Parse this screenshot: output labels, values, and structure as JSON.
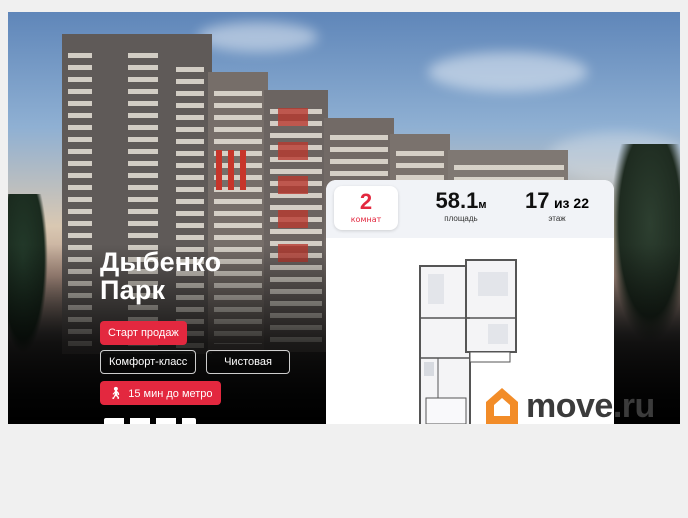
{
  "project": {
    "name_line1": "Дыбенко",
    "name_line2": "Парк"
  },
  "badges": {
    "sale": "Старт продаж",
    "class": "Комфорт-класс",
    "finish": "Чистовая",
    "metro": "15 мин до метро"
  },
  "card": {
    "rooms_value": "2",
    "rooms_label": "комнат",
    "area_value": "58.1",
    "area_unit": "м",
    "area_label": "площадь",
    "floor_value": "17",
    "floor_total": "из 22",
    "floor_label": "этаж"
  },
  "watermark": {
    "text": "move.ru"
  },
  "colors": {
    "accent": "#e3283f",
    "logo_orange": "#f28c28",
    "page_bg": "#f0f0f0"
  },
  "icons": {
    "metro": "walking-person-icon",
    "logo": "house-logo-icon"
  }
}
